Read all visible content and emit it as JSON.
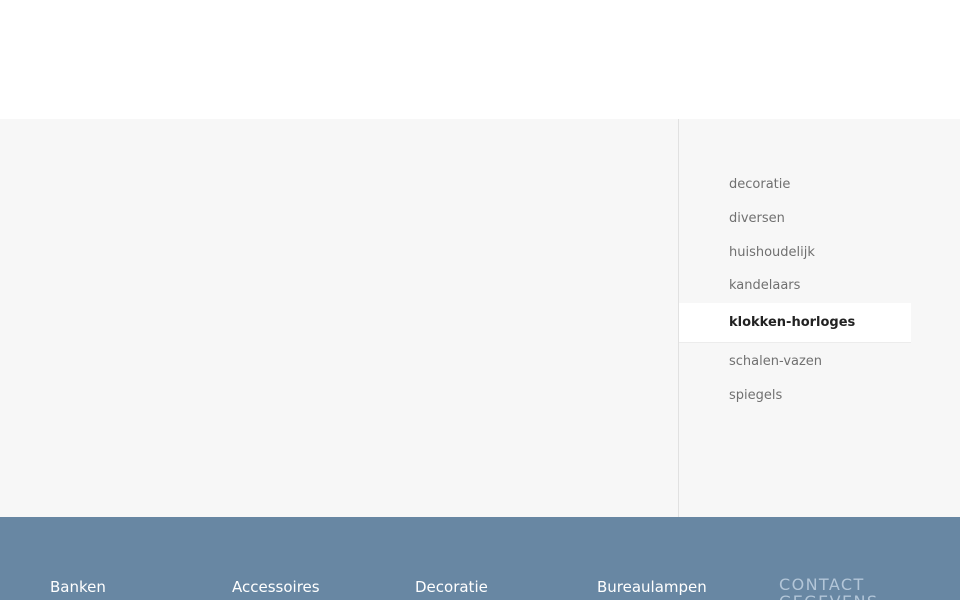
{
  "sidebar": {
    "categories": [
      {
        "label": "decoratie"
      },
      {
        "label": "diversen"
      },
      {
        "label": "huishoudelijk"
      },
      {
        "label": "kandelaars"
      },
      {
        "label": "klokken-horloges",
        "active": true
      },
      {
        "label": "schalen-vazen"
      },
      {
        "label": "spiegels"
      }
    ]
  },
  "footer": {
    "links": [
      {
        "label": "Banken"
      },
      {
        "label": "Accessoires"
      },
      {
        "label": "Decoratie"
      },
      {
        "label": "Bureaulampen"
      }
    ],
    "contact_heading": "CONTACT\nGEGEVENS"
  },
  "colors": {
    "footer_background": "#6887a3",
    "main_background": "#f7f7f7",
    "active_item_text": "#222222",
    "item_text": "#707070"
  }
}
